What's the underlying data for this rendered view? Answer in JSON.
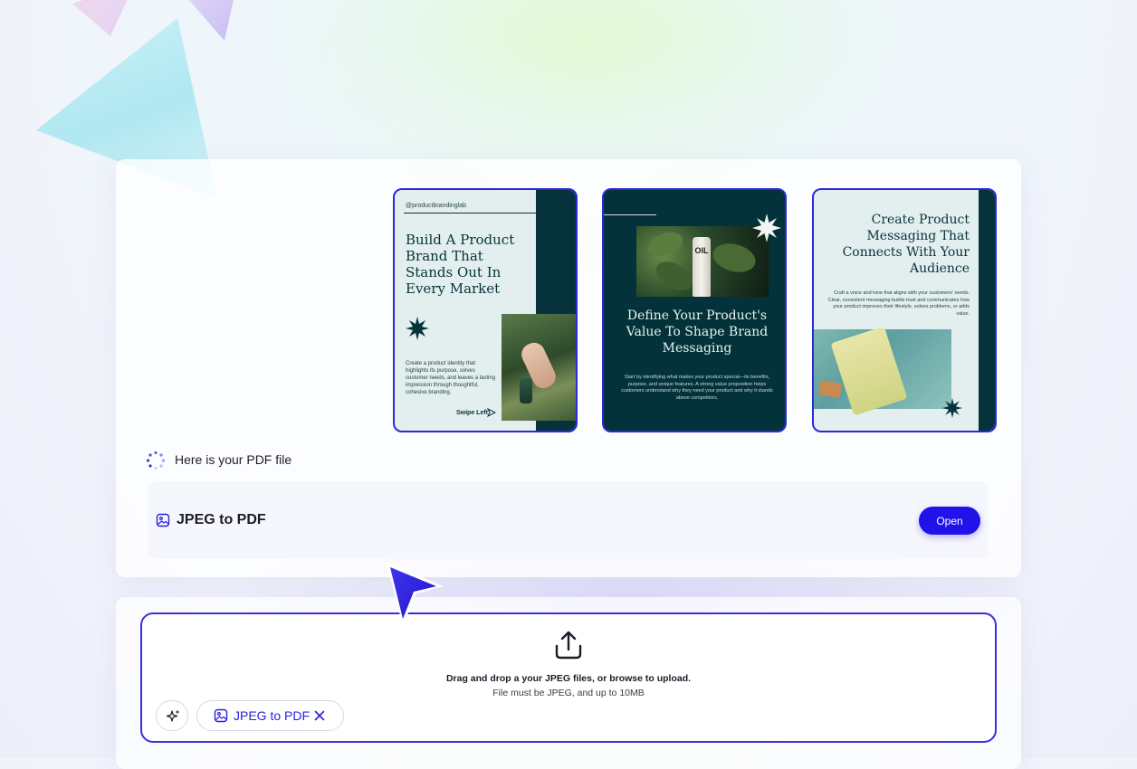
{
  "cards": {
    "card1": {
      "handle": "@productbrandinglab",
      "title": "Build A Product Brand That Stands Out In Every Market",
      "description": "Create a product identity that highlights its purpose, solves customer needs, and leaves a lasting impression through thoughtful, cohesive branding.",
      "swipe_label": "Swipe Left"
    },
    "card2": {
      "bottle_label": "OIL",
      "title": "Define Your Product's Value To Shape Brand Messaging",
      "description": "Start by identifying what makes your product special—its benefits, purpose, and unique features. A strong value proposition helps customers understand why they need your product and why it stands above competitors."
    },
    "card3": {
      "title": "Create Product Messaging That Connects With Your Audience",
      "description": "Craft a voice and tone that aligns with your customers' needs. Clear, consistent messaging builds trust and communicates how your product improves their lifestyle, solves problems, or adds value."
    }
  },
  "status": {
    "message": "Here is your PDF file"
  },
  "file": {
    "name": "JPEG to PDF",
    "open_label": "Open"
  },
  "upload": {
    "title": "Drag and drop a your JPEG files, or browse to upload.",
    "subtitle": "File must be JPEG, and up to 10MB",
    "chip_label": "JPEG to PDF"
  },
  "colors": {
    "accent": "#2012e8",
    "card_dark": "#03323a",
    "card_light": "#e3efee"
  },
  "icons": {
    "status": "spinner-icon",
    "file": "image-icon",
    "upload": "upload-icon",
    "magic": "sparkle-icon",
    "remove": "close-icon",
    "pointer": "cursor-arrow-icon"
  }
}
